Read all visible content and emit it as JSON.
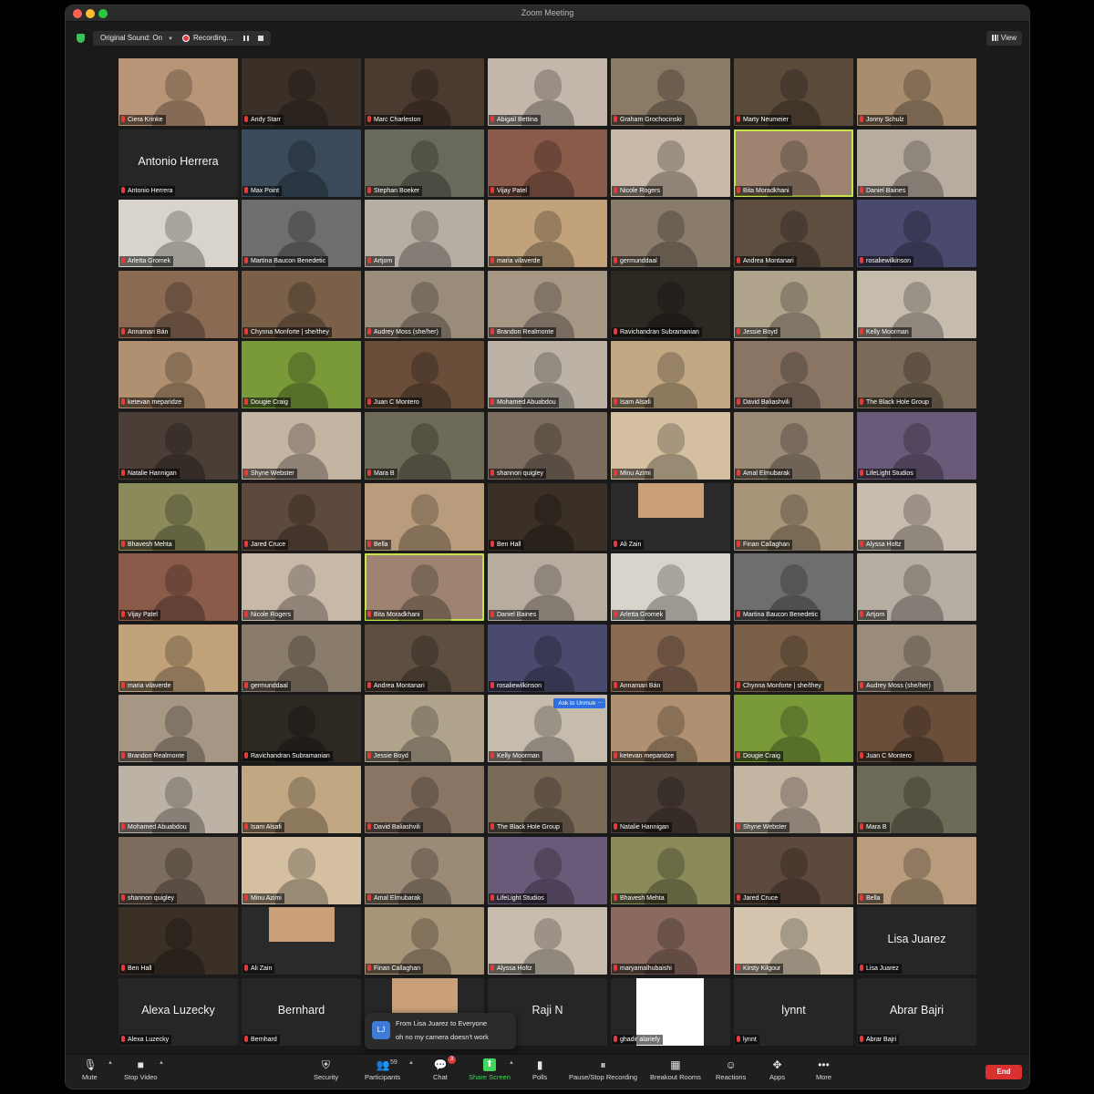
{
  "window": {
    "title": "Zoom Meeting"
  },
  "topbar": {
    "sound_label": "Original Sound: On",
    "recording_label": "Recording...",
    "view_label": "View"
  },
  "tiles": [
    {
      "name": "Ciera Krinke",
      "bg": "#b99577"
    },
    {
      "name": "Andy Starr",
      "bg": "#3b3027"
    },
    {
      "name": "Marc Charleston",
      "bg": "#4a3a2f"
    },
    {
      "name": "Abigail Bettina",
      "bg": "#c4b8ac"
    },
    {
      "name": "Graham Grochocinski",
      "bg": "#8b7a66"
    },
    {
      "name": "Marty Neumeier",
      "bg": "#5a4a3a"
    },
    {
      "name": "Jonny Schulz",
      "bg": "#a88d6e"
    },
    {
      "name": "Antonio Herrera",
      "bg": "#262626",
      "big": "Antonio Herrera"
    },
    {
      "name": "Max Point",
      "bg": "#3a4a5a"
    },
    {
      "name": "Stephan Boeker",
      "bg": "#6a6a5c"
    },
    {
      "name": "Vijay Patel",
      "bg": "#8a5a4a"
    },
    {
      "name": "Nicole Rogers",
      "bg": "#c8b8a8"
    },
    {
      "name": "Bita Moradkhani",
      "bg": "#9e8470",
      "active": true
    },
    {
      "name": "Daniel Baines",
      "bg": "#b8aca0"
    },
    {
      "name": "Arletta Gromek",
      "bg": "#d8d4cc"
    },
    {
      "name": "Martina Baucon Benedetic",
      "bg": "#6e6e6e"
    },
    {
      "name": "Artjom",
      "bg": "#b6aea2"
    },
    {
      "name": "maria vilaverde",
      "bg": "#c2a27a"
    },
    {
      "name": "germunddaal",
      "bg": "#8a7c6a"
    },
    {
      "name": "Andrea Montanari",
      "bg": "#5e4e40"
    },
    {
      "name": "rosaliewilkinson",
      "bg": "#4a4a6e"
    },
    {
      "name": "Annamari Bán",
      "bg": "#8a6a52"
    },
    {
      "name": "Chynna Monforte | she/they",
      "bg": "#7a6048"
    },
    {
      "name": "Audrey Moss (she/her)",
      "bg": "#9a8c7a"
    },
    {
      "name": "Brandon Realmonte",
      "bg": "#a69684"
    },
    {
      "name": "Ravichandran Subramanian",
      "bg": "#2e2822"
    },
    {
      "name": "Jessie Boyd",
      "bg": "#b0a48c"
    },
    {
      "name": "Kelly Moorman",
      "bg": "#c6bcae"
    },
    {
      "name": "ketevan meparidze",
      "bg": "#b09070"
    },
    {
      "name": "Dougie Craig",
      "bg": "#7a9a3a"
    },
    {
      "name": "Juan C Montero",
      "bg": "#6a4e3a"
    },
    {
      "name": "Mohamed Abuabdou",
      "bg": "#bcb2a6"
    },
    {
      "name": "Isam Alsafi",
      "bg": "#c2a882"
    },
    {
      "name": "David Baliashvili",
      "bg": "#8a7464"
    },
    {
      "name": "The Black Hole Group",
      "bg": "#7a6a58"
    },
    {
      "name": "Natalie Hannigan",
      "bg": "#4a3e36"
    },
    {
      "name": "Shyne Webster",
      "bg": "#c4b4a2"
    },
    {
      "name": "Mara B",
      "bg": "#6e6a58"
    },
    {
      "name": "shannon quigley",
      "bg": "#7c6c5e"
    },
    {
      "name": "Minu Azimi",
      "bg": "#d4c0a0"
    },
    {
      "name": "Amal Elmubarak",
      "bg": "#9a8a76"
    },
    {
      "name": "LifeLight Studios",
      "bg": "#6a5a7a"
    },
    {
      "name": "Bhavesh Mehta",
      "bg": "#8a8a5a"
    },
    {
      "name": "Jared Cruce",
      "bg": "#5e4a3c"
    },
    {
      "name": "Bella",
      "bg": "#b89c7c"
    },
    {
      "name": "Ben Hall",
      "bg": "#3a3026"
    },
    {
      "name": "Ali Zain",
      "bg": "#2a2a2a",
      "inner": "photo"
    },
    {
      "name": "Finan Callaghan",
      "bg": "#a89478"
    },
    {
      "name": "Alyssa Holtz",
      "bg": "#c8bcae"
    },
    {
      "name": "Vijay Patel",
      "bg": "#8a5a4a"
    },
    {
      "name": "Nicole Rogers",
      "bg": "#c8b8a8"
    },
    {
      "name": "Bita Moradkhani",
      "bg": "#9e8470",
      "active": true
    },
    {
      "name": "Daniel Baines",
      "bg": "#b8aca0"
    },
    {
      "name": "Arletta Gromek",
      "bg": "#d8d4cc"
    },
    {
      "name": "Martina Baucon Benedetic",
      "bg": "#6e6e6e"
    },
    {
      "name": "Artjom",
      "bg": "#b6aea2"
    },
    {
      "name": "maria vilaverde",
      "bg": "#c2a27a"
    },
    {
      "name": "germunddaal",
      "bg": "#8a7c6a"
    },
    {
      "name": "Andrea Montanari",
      "bg": "#5e4e40"
    },
    {
      "name": "rosaliewilkinson",
      "bg": "#4a4a6e"
    },
    {
      "name": "Annamari Bán",
      "bg": "#8a6a52"
    },
    {
      "name": "Chynna Monforte | she/they",
      "bg": "#7a6048"
    },
    {
      "name": "Audrey Moss (she/her)",
      "bg": "#9a8c7a"
    },
    {
      "name": "Brandon Realmonte",
      "bg": "#a69684"
    },
    {
      "name": "Ravichandran Subramanian",
      "bg": "#2e2822"
    },
    {
      "name": "Jessie Boyd",
      "bg": "#b0a48c"
    },
    {
      "name": "Kelly Moorman",
      "bg": "#c6bcae",
      "unmute": "Ask to Unmute"
    },
    {
      "name": "ketevan meparidze",
      "bg": "#b09070"
    },
    {
      "name": "Dougie Craig",
      "bg": "#7a9a3a"
    },
    {
      "name": "Juan C Montero",
      "bg": "#6a4e3a"
    },
    {
      "name": "Mohamed Abuabdou",
      "bg": "#bcb2a6"
    },
    {
      "name": "Isam Alsafi",
      "bg": "#c2a882"
    },
    {
      "name": "David Baliashvili",
      "bg": "#8a7464"
    },
    {
      "name": "The Black Hole Group",
      "bg": "#7a6a58"
    },
    {
      "name": "Natalie Hannigan",
      "bg": "#4a3e36"
    },
    {
      "name": "Shyne Webster",
      "bg": "#c4b4a2"
    },
    {
      "name": "Mara B",
      "bg": "#6e6a58"
    },
    {
      "name": "shannon quigley",
      "bg": "#7c6c5e"
    },
    {
      "name": "Minu Azimi",
      "bg": "#d4c0a0"
    },
    {
      "name": "Amal Elmubarak",
      "bg": "#9a8a76"
    },
    {
      "name": "LifeLight Studios",
      "bg": "#6a5a7a"
    },
    {
      "name": "Bhavesh Mehta",
      "bg": "#8a8a5a"
    },
    {
      "name": "Jared Cruce",
      "bg": "#5e4a3c"
    },
    {
      "name": "Bella",
      "bg": "#b89c7c"
    },
    {
      "name": "Ben Hall",
      "bg": "#3a3026"
    },
    {
      "name": "Ali Zain",
      "bg": "#2a2a2a",
      "inner": "photo"
    },
    {
      "name": "Finan Callaghan",
      "bg": "#a89478"
    },
    {
      "name": "Alyssa Holtz",
      "bg": "#c8bcae"
    },
    {
      "name": "maryamalhubaishi",
      "bg": "#8a6a5e"
    },
    {
      "name": "Kirsty Kilgour",
      "bg": "#d4c4ae"
    },
    {
      "name": "Lisa Juarez",
      "bg": "#262626",
      "big": "Lisa Juarez"
    },
    {
      "name": "Alexa Luzecky",
      "bg": "#262626",
      "big": "Alexa Luzecky"
    },
    {
      "name": "Bernhard",
      "bg": "#262626",
      "big": "Bernhard"
    },
    {
      "name": "",
      "bg": "#262626",
      "inner": "photo"
    },
    {
      "name": "",
      "bg": "#262626",
      "big": "Raji N"
    },
    {
      "name": "ghadir alariefy",
      "bg": "#262626",
      "inner": "white"
    },
    {
      "name": "lynnt",
      "bg": "#262626",
      "big": "lynnt"
    },
    {
      "name": "Abrar Bajri",
      "bg": "#262626",
      "big": "Abrar Bajri"
    }
  ],
  "toast": {
    "initials": "LJ",
    "from": "From Lisa Juarez to Everyone",
    "message": "oh no my camera doesn't work"
  },
  "toolbar": {
    "mute": "Mute",
    "stop_video": "Stop Video",
    "security": "Security",
    "participants": "Participants",
    "participants_count": "59",
    "chat": "Chat",
    "chat_badge": "3",
    "share_screen": "Share Screen",
    "polls": "Polls",
    "pause_stop_recording": "Pause/Stop Recording",
    "breakout_rooms": "Breakout Rooms",
    "reactions": "Reactions",
    "apps": "Apps",
    "more": "More",
    "end": "End"
  },
  "colors": {
    "active_speaker": "#c9e34a",
    "end_red": "#d9312f",
    "share_green": "#43d65d",
    "unmute_blue": "#2d6fe0"
  }
}
